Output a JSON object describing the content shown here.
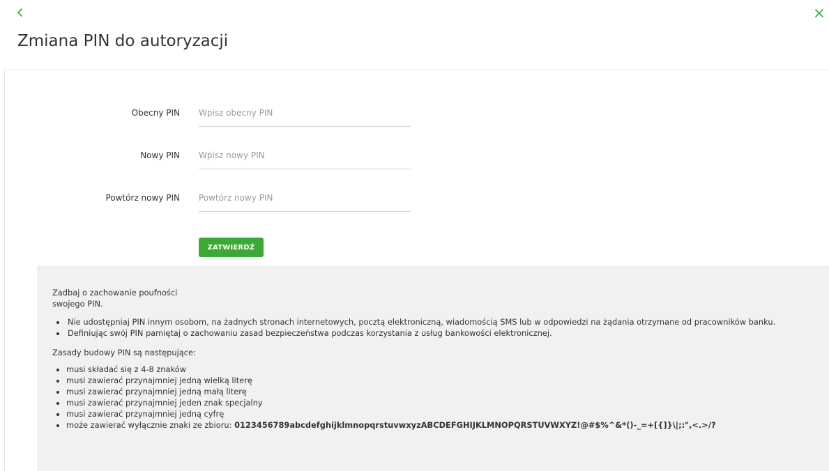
{
  "header": {
    "title": "Zmiana PIN do autoryzacji",
    "back_icon": "chevron-left-icon",
    "close_icon": "close-icon"
  },
  "form": {
    "fields": [
      {
        "label": "Obecny PIN",
        "placeholder": "Wpisz obecny PIN",
        "value": ""
      },
      {
        "label": "Nowy PIN",
        "placeholder": "Wpisz nowy PIN",
        "value": ""
      },
      {
        "label": "Powtórz nowy PIN",
        "placeholder": "Powtórz nowy PIN",
        "value": ""
      }
    ],
    "submit_label": "ZATWIERDŹ"
  },
  "info": {
    "intro_line1": "Zadbaj o zachowanie poufności",
    "intro_line2": "swojego PIN.",
    "bullets": [
      "Nie udostępniaj PIN innym osobom, na żadnych stronach internetowych, pocztą elektroniczną, wiadomością SMS lub w odpowiedzi na żądania otrzymane od pracowników banku.",
      "Definiując swój PIN pamiętaj o zachowaniu zasad bezpieczeństwa podczas korzystania z usług bankowości elektronicznej."
    ],
    "rules_heading": "Zasady budowy PIN są następujące:",
    "rules": [
      "musi składać się z 4-8 znaków",
      "musi zawierać przynajmniej jedną wielką literę",
      "musi zawierać przynajmniej jedną małą literę",
      "musi zawierać przynajmniej jeden znak specjalny",
      "musi zawierać przynajmniej jedną cyfrę"
    ],
    "charset_prefix": "może zawierać wyłącznie znaki ze zbioru: ",
    "charset": "0123456789abcdefghijklmnopqrstuvwxyzABCDEFGHIJKLMNOPQRSTUVWXYZ!@#$%^&*()-_=+[{]}\\|;:\",<.>/?"
  },
  "colors": {
    "accent": "#3aa935",
    "panel_bg": "#f1f1f1",
    "text": "#333333",
    "placeholder": "#9a9a9a"
  }
}
